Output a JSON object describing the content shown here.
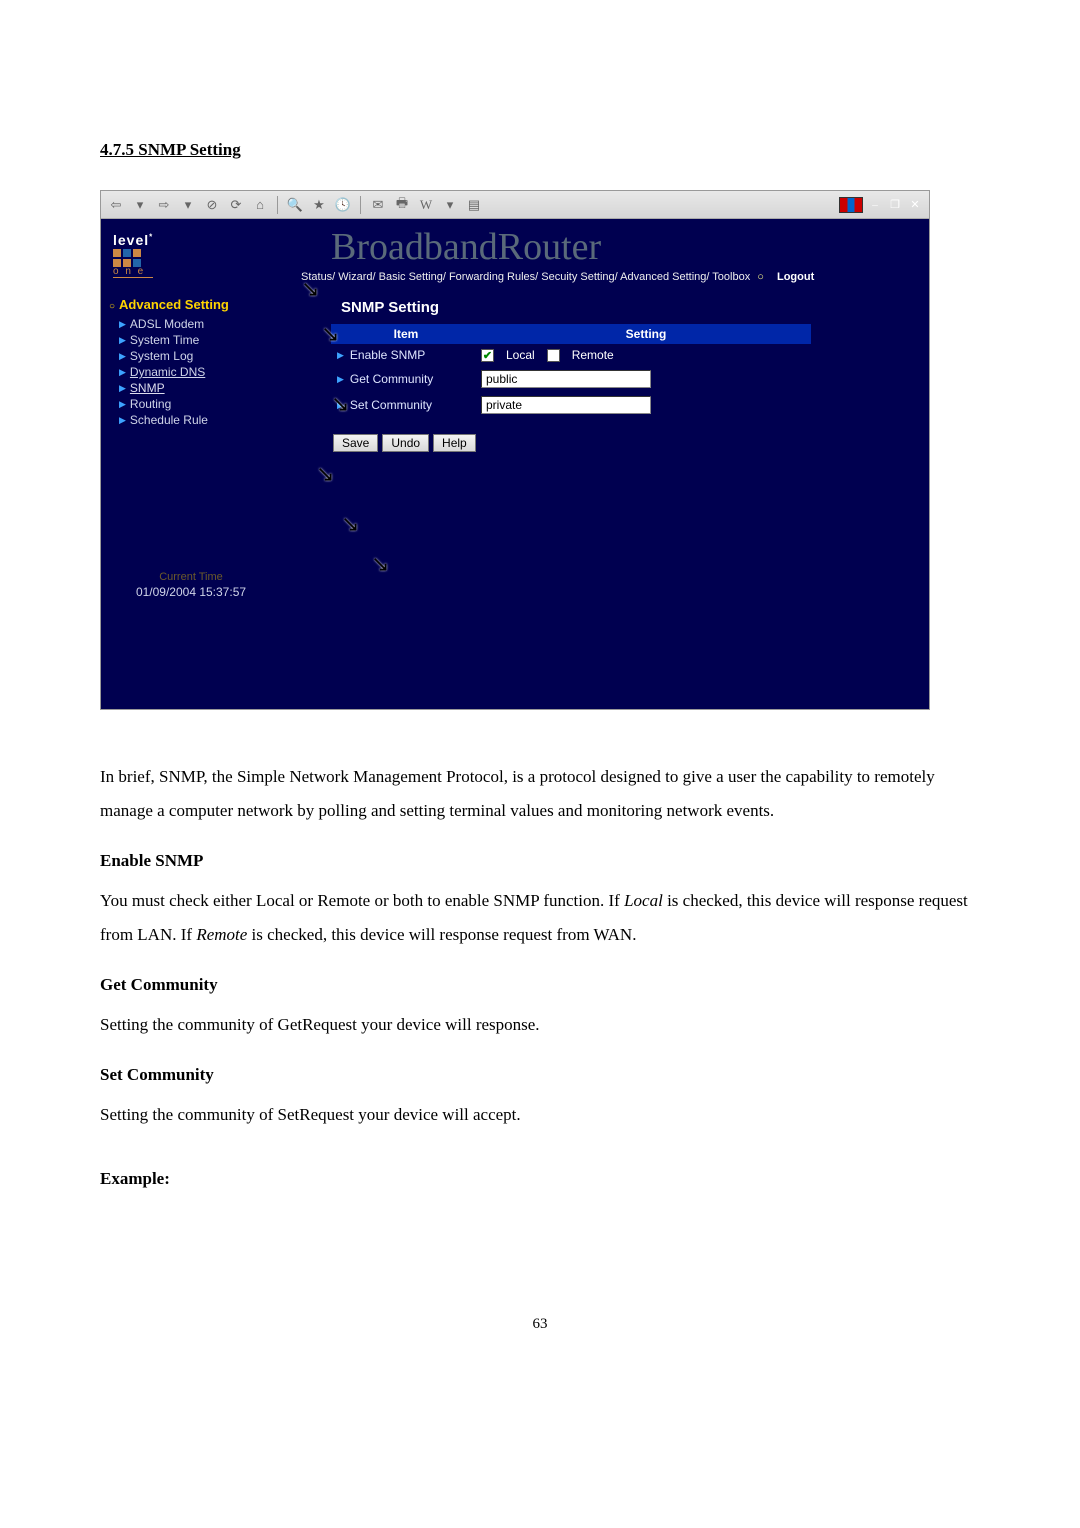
{
  "section_heading": "4.7.5 SNMP Setting",
  "router": {
    "brand_top": "level",
    "brand_one": "o n e",
    "title": "BroadbandRouter",
    "watermark": "",
    "nav": "Status/ Wizard/ Basic Setting/ Forwarding Rules/ Secuity Setting/ Advanced Setting/ Toolbox",
    "logout": "Logout"
  },
  "sidebar": {
    "title": "Advanced Setting",
    "items": [
      {
        "label": "ADSL Modem"
      },
      {
        "label": "System Time"
      },
      {
        "label": "System Log"
      },
      {
        "label": "Dynamic DNS"
      },
      {
        "label": "SNMP"
      },
      {
        "label": "Routing"
      },
      {
        "label": "Schedule Rule"
      }
    ],
    "current_time_label": "Current Time",
    "current_time": "01/09/2004 15:37:57"
  },
  "snmp": {
    "title": "SNMP Setting",
    "header_item": "Item",
    "header_setting": "Setting",
    "rows": {
      "enable": {
        "label": "Enable SNMP",
        "local_label": "Local",
        "remote_label": "Remote"
      },
      "get": {
        "label": "Get Community",
        "value": "public"
      },
      "set": {
        "label": "Set Community",
        "value": "private"
      }
    },
    "buttons": {
      "save": "Save",
      "undo": "Undo",
      "help": "Help"
    }
  },
  "doc": {
    "intro": "In brief, SNMP, the Simple Network Management Protocol, is a protocol designed to give a user the capability to remotely manage a computer network by polling and setting terminal values and monitoring network events.",
    "h_enable": "Enable SNMP",
    "p_enable_1": "You must check either Local or Remote or both to enable SNMP function. If ",
    "p_enable_local": "Local",
    "p_enable_2": " is checked, this device will response request from LAN. If ",
    "p_enable_remote": "Remote",
    "p_enable_3": " is checked, this device will response request from WAN.",
    "h_get": "Get Community",
    "p_get": "Setting the community of GetRequest your device will response.",
    "h_set": "Set Community",
    "p_set": "Setting the community of SetRequest your device will accept.",
    "h_example": "Example:"
  },
  "page_number": "63"
}
